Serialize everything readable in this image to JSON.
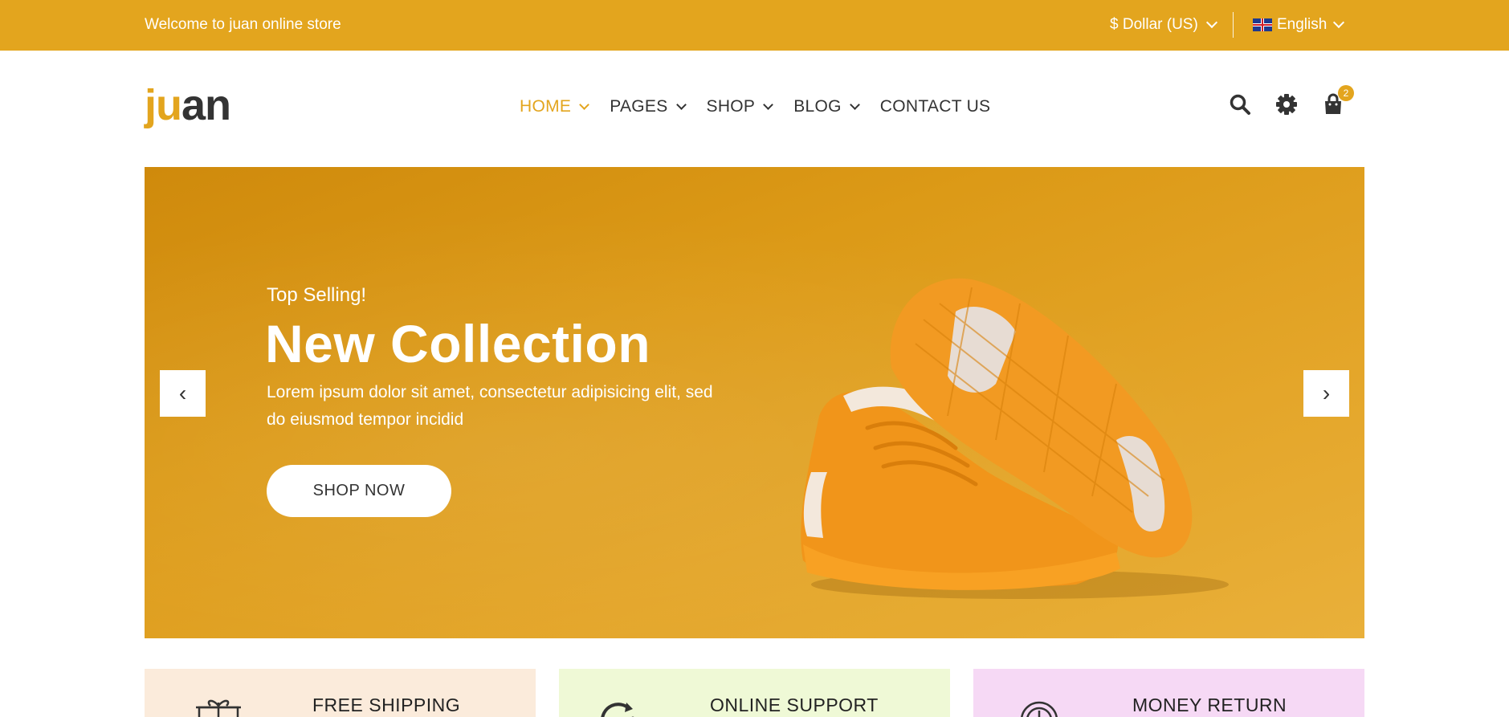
{
  "topbar": {
    "welcome": "Welcome to juan online store",
    "currency": "$ Dollar (US)",
    "language": "English",
    "flag_icon": "uk-flag-icon",
    "background": "#e3a51e"
  },
  "header": {
    "logo_part1": "ju",
    "logo_part2": "an",
    "nav": [
      {
        "label": "HOME",
        "active": true,
        "dropdown": true
      },
      {
        "label": "PAGES",
        "active": false,
        "dropdown": true
      },
      {
        "label": "SHOP",
        "active": false,
        "dropdown": true
      },
      {
        "label": "BLOG",
        "active": false,
        "dropdown": true
      },
      {
        "label": "CONTACT US",
        "active": false,
        "dropdown": false
      }
    ],
    "icons": [
      "search-icon",
      "settings-icon",
      "cart-icon"
    ],
    "cart_count": "2"
  },
  "hero": {
    "eyebrow": "Top Selling!",
    "title": "New Collection",
    "description": "Lorem ipsum dolor sit amet, consectetur adipisicing elit, sed do eiusmod tempor incidid",
    "cta": "SHOP NOW",
    "prev_arrow": "‹",
    "next_arrow": "›"
  },
  "features": [
    {
      "label": "FREE SHIPPING",
      "icon": "gift-icon",
      "color": "#fbebdb"
    },
    {
      "label": "ONLINE SUPPORT",
      "icon": "support-icon",
      "color": "#eff9d6"
    },
    {
      "label": "MONEY RETURN",
      "icon": "money-return-icon",
      "color": "#f6d9f5"
    }
  ],
  "colors": {
    "accent": "#e3a51e",
    "text": "#333333"
  }
}
